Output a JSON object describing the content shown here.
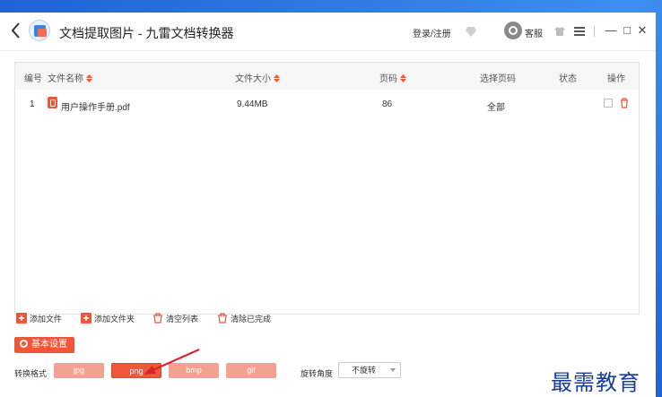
{
  "window": {
    "title": "文档提取图片 - 九雷文档转换器",
    "login": "登录/注册",
    "service": "客服",
    "minimize": "—",
    "maximize": "□",
    "close": "✕"
  },
  "table": {
    "headers": [
      "编号",
      "文件名称",
      "文件大小",
      "页码",
      "选择页码",
      "状态",
      "操作"
    ],
    "rows": [
      {
        "index": "1",
        "name": "用户操作手册.pdf",
        "size": "9.44MB",
        "pages": "86",
        "selected_pages": "全部",
        "status": ""
      }
    ]
  },
  "toolbar": {
    "add_file": "添加文件",
    "add_folder": "添加文件夹",
    "clear_list": "清空列表",
    "clear_done": "清除已完成"
  },
  "settings": {
    "label": "基本设置"
  },
  "format": {
    "label": "转换格式",
    "options": [
      "jpg",
      "png",
      "bmp",
      "gif"
    ],
    "selected": "png"
  },
  "rotation": {
    "label": "旋转角度",
    "value": "不旋转"
  },
  "watermark": "最需教育",
  "colors": {
    "accent": "#f0573a",
    "accent_light": "#f4a191",
    "desktop": "#2a6fd8"
  }
}
